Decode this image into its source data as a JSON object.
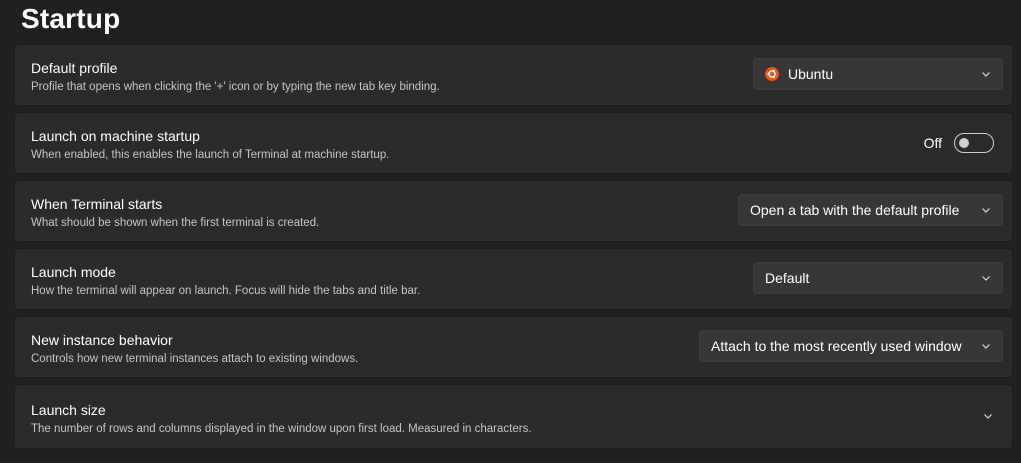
{
  "page": {
    "title": "Startup"
  },
  "colors": {
    "background": "#202020",
    "card": "#2b2b2b",
    "combo": "#373737",
    "ubuntu_orange": "#e95420"
  },
  "settings": {
    "default_profile": {
      "title": "Default profile",
      "description": "Profile that opens when clicking the '+' icon or by typing the new tab key binding.",
      "value": "Ubuntu",
      "icon": "ubuntu-icon"
    },
    "launch_on_startup": {
      "title": "Launch on machine startup",
      "description": "When enabled, this enables the launch of Terminal at machine startup.",
      "state_label": "Off",
      "enabled": false
    },
    "when_terminal_starts": {
      "title": "When Terminal starts",
      "description": "What should be shown when the first terminal is created.",
      "value": "Open a tab with the default profile"
    },
    "launch_mode": {
      "title": "Launch mode",
      "description": "How the terminal will appear on launch. Focus will hide the tabs and title bar.",
      "value": "Default"
    },
    "new_instance_behavior": {
      "title": "New instance behavior",
      "description": "Controls how new terminal instances attach to existing windows.",
      "value": "Attach to the most recently used window"
    },
    "launch_size": {
      "title": "Launch size",
      "description": "The number of rows and columns displayed in the window upon first load. Measured in characters.",
      "icon": "chevron-down-icon"
    }
  }
}
